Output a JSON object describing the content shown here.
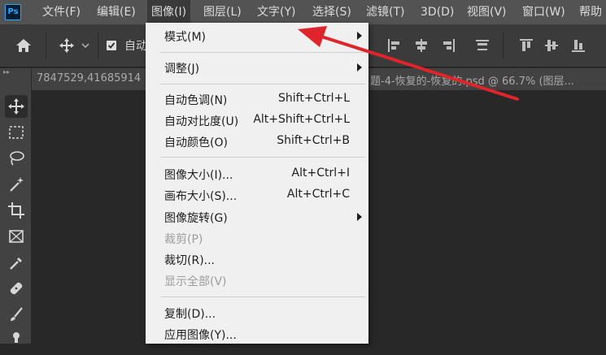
{
  "app": {
    "logo_text": "Ps"
  },
  "menubar": {
    "items": [
      {
        "label": "文件(F)"
      },
      {
        "label": "编辑(E)"
      },
      {
        "label": "图像(I)"
      },
      {
        "label": "图层(L)"
      },
      {
        "label": "文字(Y)"
      },
      {
        "label": "选择(S)"
      },
      {
        "label": "滤镜(T)"
      },
      {
        "label": "3D(D)"
      },
      {
        "label": "视图(V)"
      },
      {
        "label": "窗口(W)"
      },
      {
        "label": "帮助"
      }
    ]
  },
  "options_bar": {
    "auto_select_label": "自动",
    "auto_select_checked": true
  },
  "document_tabs": {
    "tab1": "7847529,41685914",
    "tab2": "题-4-恢复的-恢复的.psd @ 66.7% (图层..."
  },
  "image_menu": {
    "items": [
      {
        "label": "模式(M)",
        "shortcut": "",
        "submenu": true,
        "disabled": false
      },
      {
        "label": "调整(J)",
        "shortcut": "",
        "submenu": true,
        "disabled": false
      },
      {
        "label": "自动色调(N)",
        "shortcut": "Shift+Ctrl+L",
        "submenu": false,
        "disabled": false
      },
      {
        "label": "自动对比度(U)",
        "shortcut": "Alt+Shift+Ctrl+L",
        "submenu": false,
        "disabled": false
      },
      {
        "label": "自动颜色(O)",
        "shortcut": "Shift+Ctrl+B",
        "submenu": false,
        "disabled": false
      },
      {
        "label": "图像大小(I)...",
        "shortcut": "Alt+Ctrl+I",
        "submenu": false,
        "disabled": false
      },
      {
        "label": "画布大小(S)...",
        "shortcut": "Alt+Ctrl+C",
        "submenu": false,
        "disabled": false
      },
      {
        "label": "图像旋转(G)",
        "shortcut": "",
        "submenu": true,
        "disabled": false
      },
      {
        "label": "裁剪(P)",
        "shortcut": "",
        "submenu": false,
        "disabled": true
      },
      {
        "label": "裁切(R)...",
        "shortcut": "",
        "submenu": false,
        "disabled": false
      },
      {
        "label": "显示全部(V)",
        "shortcut": "",
        "submenu": false,
        "disabled": true
      },
      {
        "label": "复制(D)...",
        "shortcut": "",
        "submenu": false,
        "disabled": false
      },
      {
        "label": "应用图像(Y)...",
        "shortcut": "",
        "submenu": false,
        "disabled": false
      }
    ]
  },
  "colors": {
    "menubar_bg": "#535353",
    "menu_bg": "#f0f0f0",
    "annotation_arrow": "#e0242c",
    "ps_blue": "#31a8ff"
  }
}
